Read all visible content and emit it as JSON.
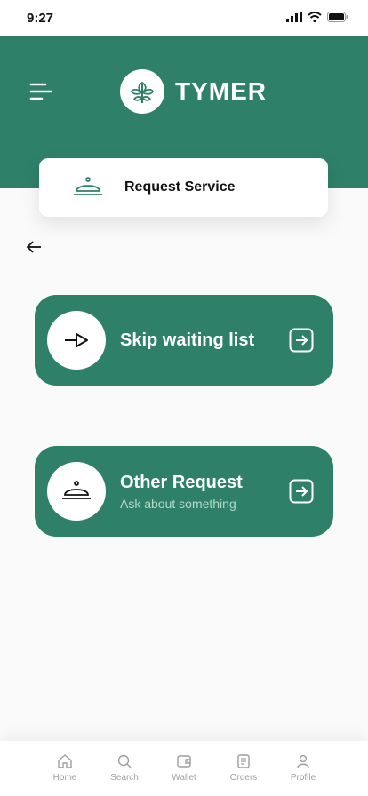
{
  "status_bar": {
    "time": "9:27"
  },
  "header": {
    "brand": "TYMER"
  },
  "request_card": {
    "label": "Request Service"
  },
  "actions": [
    {
      "title": "Skip waiting list",
      "subtitle": ""
    },
    {
      "title": "Other Request",
      "subtitle": "Ask about something"
    }
  ],
  "tabs": [
    {
      "label": "Home",
      "icon": "home-icon"
    },
    {
      "label": "Search",
      "icon": "search-icon"
    },
    {
      "label": "Wallet",
      "icon": "wallet-icon"
    },
    {
      "label": "Orders",
      "icon": "orders-icon"
    },
    {
      "label": "Profile",
      "icon": "profile-icon"
    }
  ],
  "colors": {
    "brand_green": "#2e8168",
    "background": "#fafafa",
    "subtitle": "#b7d9cc",
    "tab_inactive": "#9e9e9e"
  }
}
